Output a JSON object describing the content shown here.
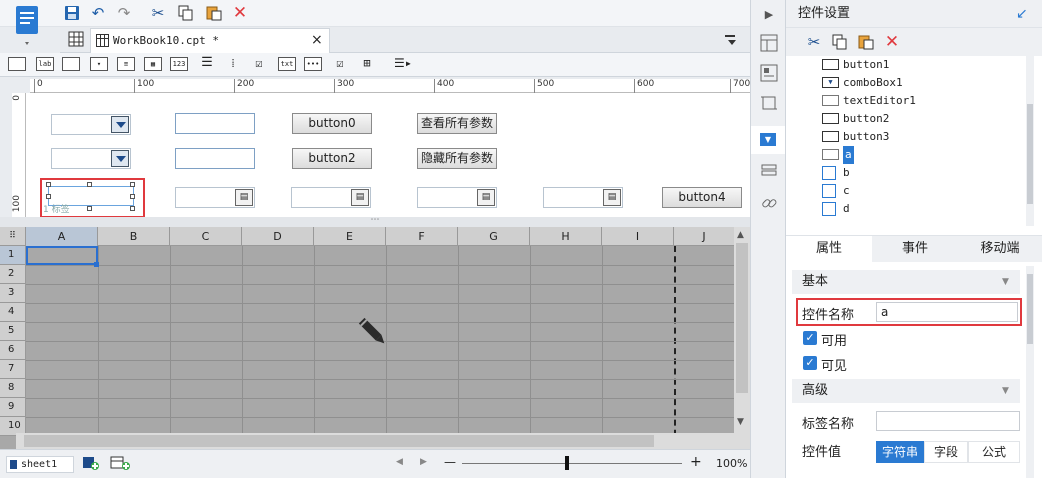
{
  "document": {
    "tab_title": "WorkBook10.cpt *",
    "close_glyph": "×"
  },
  "ruler": {
    "h_ticks": [
      "0",
      "100",
      "200",
      "300",
      "400",
      "500",
      "600",
      "700"
    ],
    "v_ticks": [
      "0",
      "100"
    ]
  },
  "form": {
    "buttons": [
      "button0",
      "button2",
      "button4"
    ],
    "show_all_params": "查看所有参数",
    "hide_all_params": "隐藏所有参数",
    "selected_label_fragment": "1 标签"
  },
  "grid": {
    "columns": [
      "A",
      "B",
      "C",
      "D",
      "E",
      "F",
      "G",
      "H",
      "I",
      "J"
    ],
    "rows": [
      "1",
      "2",
      "3",
      "4",
      "5",
      "6",
      "7",
      "8",
      "9",
      "10"
    ]
  },
  "statusbar": {
    "sheet": "sheet1",
    "zoom": "100%",
    "minus": "—",
    "plus": "+"
  },
  "right_panel": {
    "title": "控件设置",
    "tree": [
      "button1",
      "comboBox1",
      "textEditor1",
      "button2",
      "button3",
      "a",
      "b",
      "c",
      "d"
    ],
    "tabs": [
      "属性",
      "事件",
      "移动端"
    ],
    "section_basic": "基本",
    "widget_name_label": "控件名称",
    "widget_name_value": "a",
    "enabled_label": "可用",
    "visible_label": "可见",
    "section_advanced": "高级",
    "label_name_label": "标签名称",
    "widget_value_label": "控件值",
    "value_types": [
      "字符串",
      "字段",
      "公式"
    ]
  },
  "colors": {
    "accent": "#2a7ad2",
    "highlight_border": "#e0393e",
    "grid_bg": "#a8a8a8"
  }
}
